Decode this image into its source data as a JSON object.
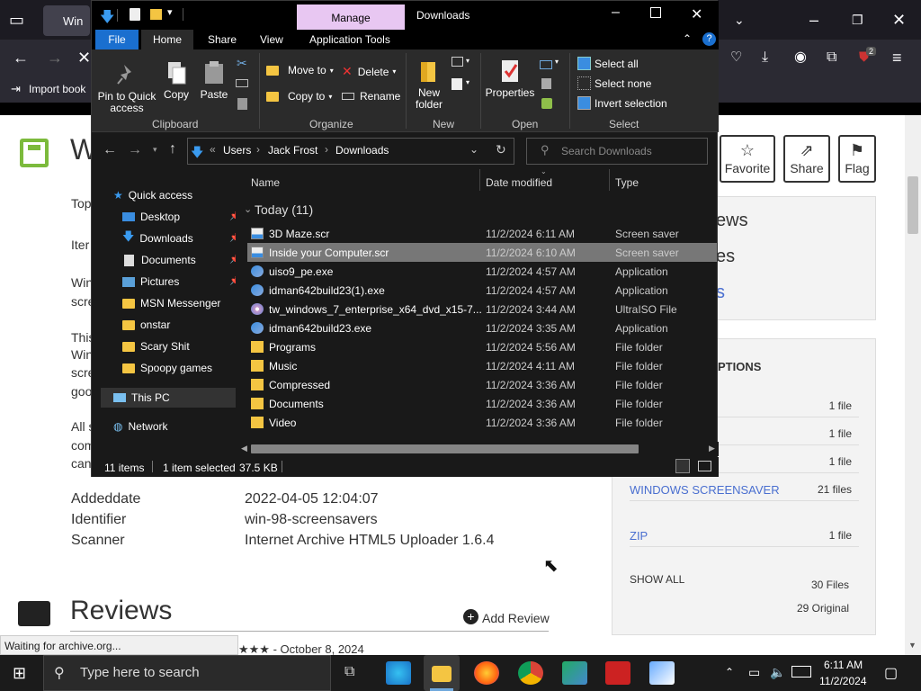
{
  "browser": {
    "tab_label": "Win",
    "toolbar_item": "Import book",
    "extension_badge": "2",
    "status_text": "Waiting for archive.org..."
  },
  "page": {
    "title_initial": "W",
    "left_texts": [
      "Top",
      "Iter",
      "Win",
      "scre",
      "This",
      "Win",
      "scre",
      "goo",
      "All s",
      "com",
      "can"
    ],
    "actions": [
      {
        "label": "Favorite",
        "icon": "star-icon"
      },
      {
        "label": "Share",
        "icon": "share-icon"
      },
      {
        "label": "Flag",
        "icon": "flag-icon"
      }
    ],
    "panel_fragments": [
      "ews",
      "es",
      "s"
    ],
    "options_heading_fragment": "PTIONS",
    "file_rows": [
      {
        "label": "",
        "count": "1 file"
      },
      {
        "label": "",
        "count": "1 file"
      },
      {
        "label": "",
        "count": "1 file"
      },
      {
        "label": "WINDOWS SCREENSAVER",
        "count": "21 files"
      },
      {
        "label": "ZIP",
        "count": "1 file"
      }
    ],
    "show_all": "SHOW ALL",
    "files_total": "30 Files",
    "files_original": "29 Original",
    "metadata": [
      {
        "key": "Addeddate",
        "value": "2022-04-05 12:04:07"
      },
      {
        "key": "Identifier",
        "value": "win-98-screensavers"
      },
      {
        "key": "Scanner",
        "value": "Internet Archive HTML5 Uploader 1.6.4"
      }
    ],
    "reviews_heading": "Reviews",
    "add_review": "Add Review",
    "review_date": "★★★ - October 8, 2024"
  },
  "explorer": {
    "window_title": "Downloads",
    "manage_tab": "Manage",
    "ribbon_tabs": [
      "File",
      "Home",
      "Share",
      "View",
      "Application Tools"
    ],
    "clipboard": {
      "pin": "Pin to Quick access",
      "copy": "Copy",
      "paste": "Paste",
      "label": "Clipboard"
    },
    "organize": {
      "move_to": "Move to",
      "copy_to": "Copy to",
      "delete": "Delete",
      "rename": "Rename",
      "label": "Organize"
    },
    "new": {
      "new_folder": "New folder",
      "label": "New"
    },
    "open": {
      "properties": "Properties",
      "label": "Open"
    },
    "select": {
      "select_all": "Select all",
      "select_none": "Select none",
      "invert": "Invert selection",
      "label": "Select"
    },
    "address": {
      "prefix": "«",
      "parts": [
        "Users",
        "Jack Frost",
        "Downloads"
      ]
    },
    "search_placeholder": "Search Downloads",
    "nav": {
      "quick_access": "Quick access",
      "items": [
        "Desktop",
        "Downloads",
        "Documents",
        "Pictures",
        "MSN Messenger",
        "onstar",
        "Scary Shit",
        "Spoopy games"
      ],
      "this_pc": "This PC",
      "network": "Network"
    },
    "columns": [
      "Name",
      "Date modified",
      "Type"
    ],
    "group_label": "Today (11)",
    "files": [
      {
        "name": "3D Maze.scr",
        "date": "11/2/2024 6:11 AM",
        "type": "Screen saver",
        "icon": "screensaver-icon"
      },
      {
        "name": "Inside your Computer.scr",
        "date": "11/2/2024 6:10 AM",
        "type": "Screen saver",
        "icon": "screensaver-icon"
      },
      {
        "name": "uiso9_pe.exe",
        "date": "11/2/2024 4:57 AM",
        "type": "Application",
        "icon": "app-icon"
      },
      {
        "name": "idman642build23(1).exe",
        "date": "11/2/2024 4:57 AM",
        "type": "Application",
        "icon": "app-icon"
      },
      {
        "name": "tw_windows_7_enterprise_x64_dvd_x15-7...",
        "date": "11/2/2024 3:44 AM",
        "type": "UltraISO File",
        "icon": "disc-icon"
      },
      {
        "name": "idman642build23.exe",
        "date": "11/2/2024 3:35 AM",
        "type": "Application",
        "icon": "app-icon"
      },
      {
        "name": "Programs",
        "date": "11/2/2024 5:56 AM",
        "type": "File folder",
        "icon": "folder-icon"
      },
      {
        "name": "Music",
        "date": "11/2/2024 4:11 AM",
        "type": "File folder",
        "icon": "folder-icon"
      },
      {
        "name": "Compressed",
        "date": "11/2/2024 3:36 AM",
        "type": "File folder",
        "icon": "folder-icon"
      },
      {
        "name": "Documents",
        "date": "11/2/2024 3:36 AM",
        "type": "File folder",
        "icon": "folder-icon"
      },
      {
        "name": "Video",
        "date": "11/2/2024 3:36 AM",
        "type": "File folder",
        "icon": "folder-icon"
      }
    ],
    "selected_index": 1,
    "status": {
      "items": "11 items",
      "selected": "1 item selected",
      "size": "37.5 KB"
    }
  },
  "taskbar": {
    "search_placeholder": "Type here to search",
    "time": "6:11 AM",
    "date": "11/2/2024"
  },
  "colors": {
    "accent": "#1a6fcf",
    "manage": "#e8c7f2",
    "folder": "#f4c542",
    "selection": "#777777"
  }
}
